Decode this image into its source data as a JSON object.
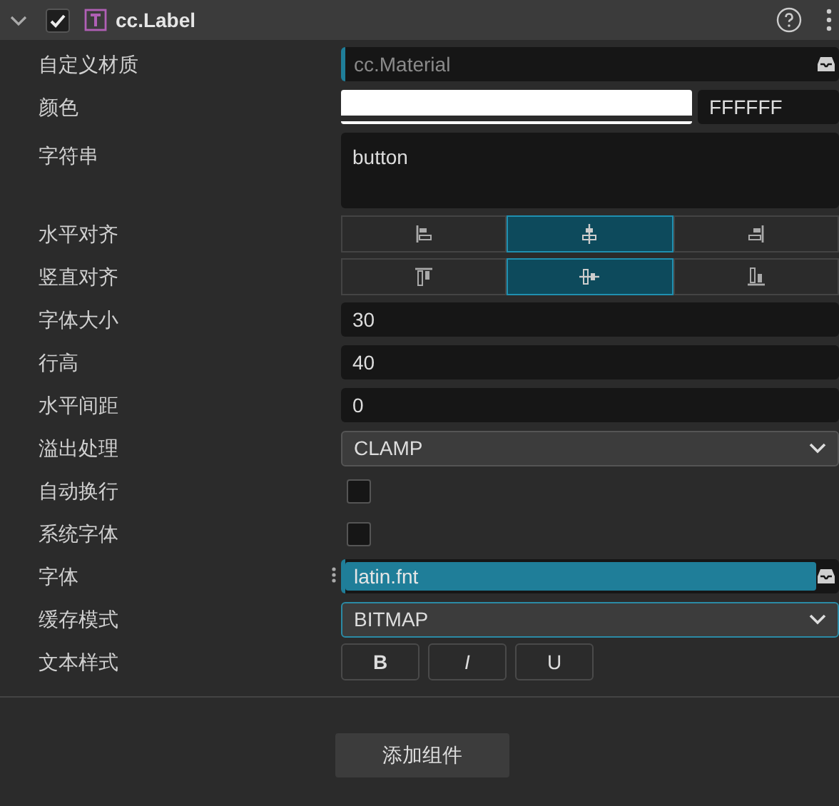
{
  "component": {
    "title": "cc.Label",
    "expanded": true,
    "enabled": true
  },
  "properties": [
    {
      "kind": "asset",
      "label": "自定义材质",
      "placeholder": "cc.Material",
      "highlighted": false,
      "draggable": false
    },
    {
      "kind": "color",
      "label": "颜色",
      "color": "#ffffff",
      "hex": "FFFFFF"
    },
    {
      "kind": "textarea",
      "label": "字符串",
      "value": "button"
    },
    {
      "kind": "halign",
      "label": "水平对齐",
      "options": [
        {
          "selected": false
        },
        {
          "selected": true
        },
        {
          "selected": false
        }
      ]
    },
    {
      "kind": "valign",
      "label": "竖直对齐",
      "options": [
        {
          "selected": false
        },
        {
          "selected": true
        },
        {
          "selected": false
        }
      ]
    },
    {
      "kind": "number",
      "label": "字体大小",
      "value": "30"
    },
    {
      "kind": "number",
      "label": "行高",
      "value": "40"
    },
    {
      "kind": "number",
      "label": "水平间距",
      "value": "0"
    },
    {
      "kind": "select",
      "label": "溢出处理",
      "value": "CLAMP",
      "focused": false
    },
    {
      "kind": "checkbox",
      "label": "自动换行",
      "checked": false
    },
    {
      "kind": "checkbox",
      "label": "系统字体",
      "checked": false
    },
    {
      "kind": "asset",
      "label": "字体",
      "value": "latin.fnt",
      "highlighted": true,
      "draggable": true
    },
    {
      "kind": "select",
      "label": "缓存模式",
      "value": "BITMAP",
      "focused": true
    },
    {
      "kind": "styles",
      "label": "文本样式",
      "options": [
        {
          "text": "B",
          "selected": false
        },
        {
          "text": "I",
          "selected": false
        },
        {
          "text": "U",
          "selected": false
        }
      ]
    }
  ],
  "add_button": "添加组件"
}
